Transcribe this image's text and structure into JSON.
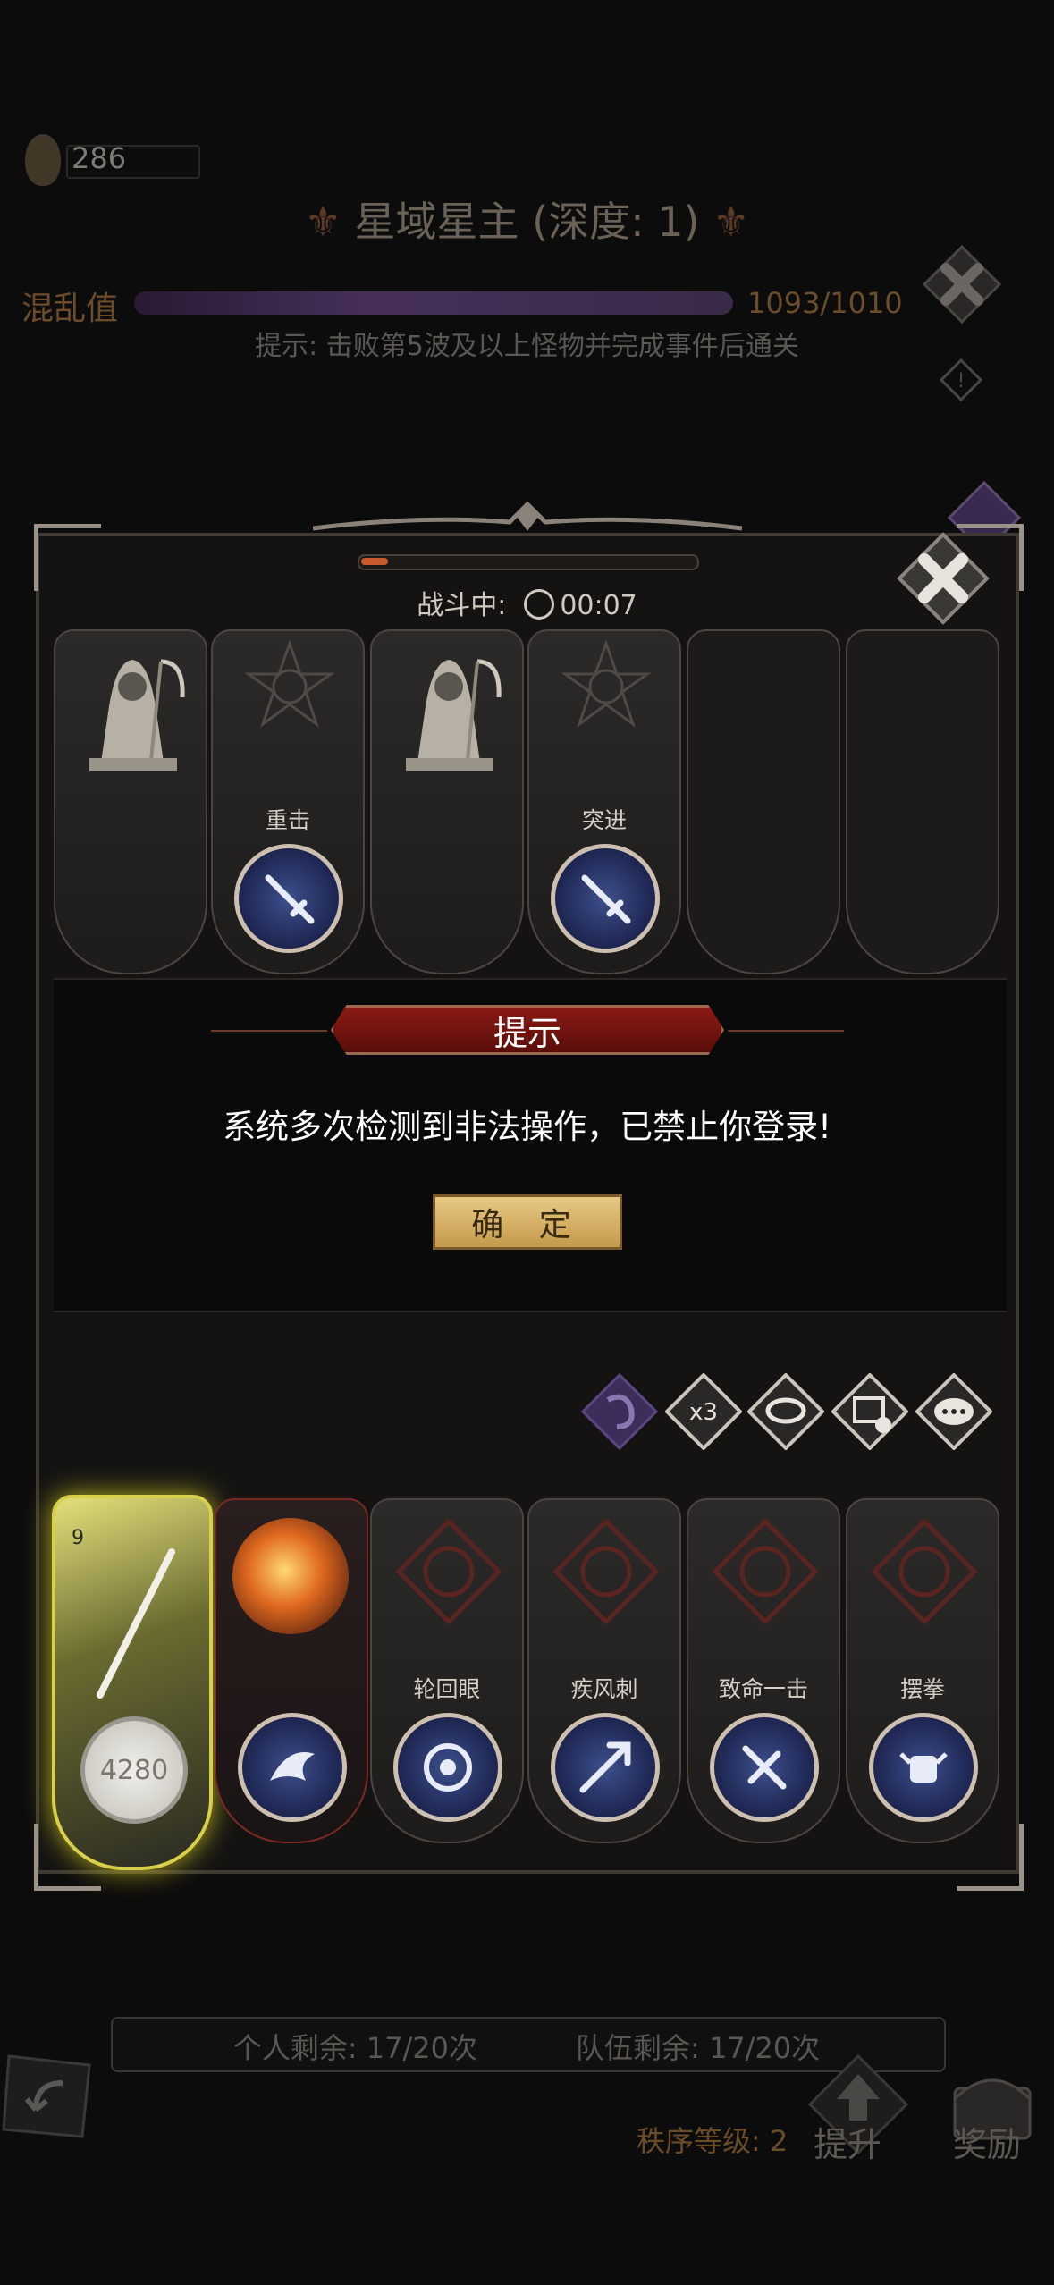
{
  "background": {
    "coin_value": "286",
    "title": "星域星主 (深度: 1)",
    "chaos_label": "混乱值",
    "chaos_value": "1093/1010",
    "chaos_fraction": 1.0,
    "hint": "提示: 击败第5波及以上怪物并完成事件后通关"
  },
  "battle": {
    "status_label": "战斗中:",
    "timer": "00:07",
    "progress_fraction": 0.08
  },
  "top_cards": [
    {
      "type": "reaper",
      "label": ""
    },
    {
      "type": "skill",
      "label": "重击",
      "icon": "sword-icon"
    },
    {
      "type": "reaper",
      "label": ""
    },
    {
      "type": "skill",
      "label": "突进",
      "icon": "sword-icon"
    },
    {
      "type": "empty",
      "label": ""
    },
    {
      "type": "empty",
      "label": ""
    }
  ],
  "dialog": {
    "title": "提示",
    "message": "系统多次检测到非法操作，已禁止你登录!",
    "confirm_label": "确 定"
  },
  "actions": [
    {
      "name": "potion-icon"
    },
    {
      "name": "speed-x3",
      "label": "x3"
    },
    {
      "name": "auto-icon"
    },
    {
      "name": "disable-icon"
    },
    {
      "name": "chat-icon"
    }
  ],
  "hero": {
    "level": "9",
    "value": "4280"
  },
  "bottom_skills": [
    {
      "label": "轮回眼",
      "icon": "eye-icon"
    },
    {
      "label": "疾风刺",
      "icon": "wind-spear-icon"
    },
    {
      "label": "致命一击",
      "icon": "fatal-strike-icon"
    },
    {
      "label": "摆拳",
      "icon": "fist-icon"
    }
  ],
  "footer": {
    "personal": "个人剩余: 17/20次",
    "team": "队伍剩余: 17/20次",
    "rank": "秩序等级: 2",
    "upgrade_label": "提升",
    "reward_label": "奖励"
  },
  "colors": {
    "accent_red": "#8a1b14",
    "confirm_gold": "#d8b363",
    "skill_blue": "#2d3c78"
  }
}
